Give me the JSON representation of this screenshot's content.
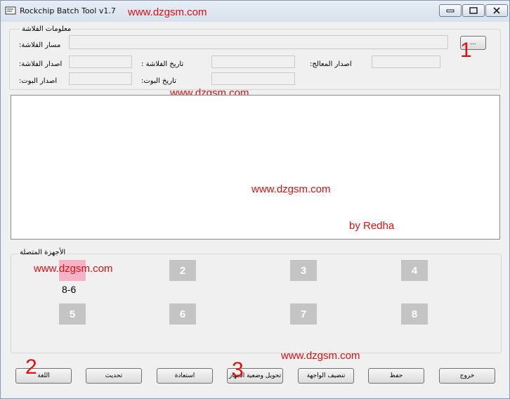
{
  "window": {
    "title": "Rockchip Batch Tool v1.7",
    "watermark": "www.dzgsm.com"
  },
  "firmware": {
    "group_label": "معلومات الفلاشة",
    "path_label": ":مسار الفلاشة",
    "browse_label": "...",
    "firmware_version_label": ":اصدار الفلاشة",
    "firmware_date_label": ": تاريخ الفلاشة",
    "chip_version_label": ":اصدار المعالج",
    "boot_version_label": ":اصدار البوت",
    "boot_date_label": ":تاريخ البوت",
    "path_value": "",
    "firmware_version_value": "",
    "firmware_date_value": "",
    "chip_version_value": "",
    "boot_version_value": "",
    "boot_date_value": ""
  },
  "log": {
    "author": "by Redha"
  },
  "devices": {
    "group_label": "الأجهزة المتصلة",
    "slots": [
      {
        "label": "",
        "caption": "8-6",
        "active": true
      },
      {
        "label": "2",
        "active": false
      },
      {
        "label": "3",
        "active": false
      },
      {
        "label": "4",
        "active": false
      },
      {
        "label": "5",
        "active": false
      },
      {
        "label": "6",
        "active": false
      },
      {
        "label": "7",
        "active": false
      },
      {
        "label": "8",
        "active": false
      }
    ]
  },
  "toolbar": {
    "language": "اللغة",
    "update": "تحديث",
    "restore": "استعادة",
    "switch_device": "تحويل وضعية الجهاز",
    "clean": "تنضيف الواجهة",
    "save": "حفظ",
    "exit": "خروج"
  },
  "annotations": [
    "1",
    "2",
    "3"
  ],
  "colors": {
    "watermark": "#e01010",
    "device_active": "#f6b3c7",
    "device_idle": "#c4c4c4"
  }
}
